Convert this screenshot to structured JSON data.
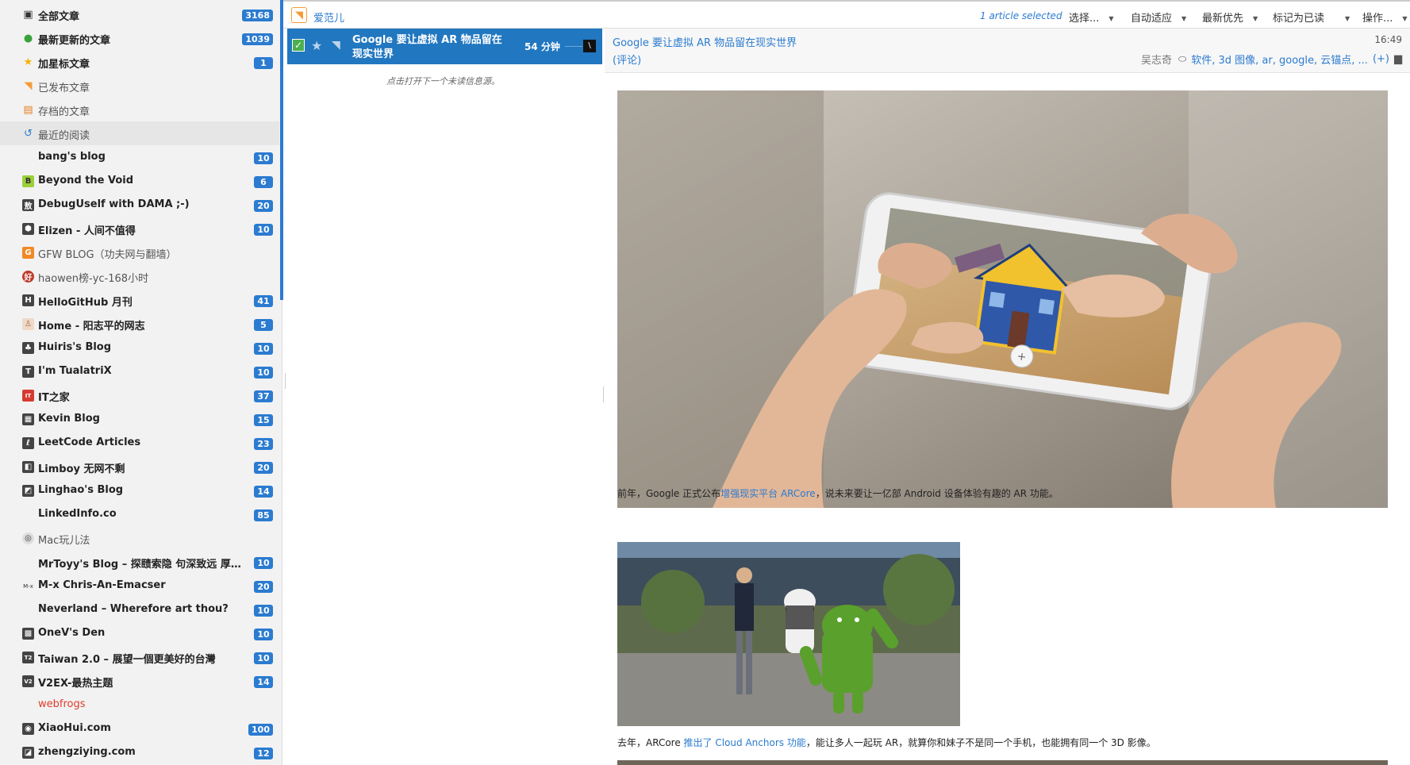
{
  "sidebar": {
    "items": [
      {
        "label": "全部文章",
        "count": "3168",
        "icon": "inbox-icon",
        "glyph": "▣",
        "style": "bold"
      },
      {
        "label": "最新更新的文章",
        "count": "1039",
        "icon": "fresh-icon",
        "glyph": "●",
        "style": "bold"
      },
      {
        "label": "加星标文章",
        "count": "1",
        "icon": "star-icon",
        "glyph": "★",
        "style": "bold"
      },
      {
        "label": "已发布文章",
        "count": "",
        "icon": "rss-icon",
        "glyph": "◥",
        "style": "gray"
      },
      {
        "label": "存档的文章",
        "count": "",
        "icon": "archive-icon",
        "glyph": "▤",
        "style": "gray"
      },
      {
        "label": "最近的阅读",
        "count": "",
        "icon": "history-icon",
        "glyph": "↺",
        "style": "gray"
      },
      {
        "label": "bang's blog",
        "count": "10",
        "icon": "",
        "glyph": "",
        "style": "bold"
      },
      {
        "label": "Beyond the Void",
        "count": "6",
        "icon": "btv-favicon-icon",
        "glyph": "B",
        "style": "bold"
      },
      {
        "label": "DebugUself with DAMA ;-)",
        "count": "20",
        "icon": "debug-favicon-icon",
        "glyph": "敖",
        "style": "bold"
      },
      {
        "label": "Elizen - 人间不值得",
        "count": "10",
        "icon": "elizen-favicon-icon",
        "glyph": "⬢",
        "style": "bold"
      },
      {
        "label": "GFW BLOG（功夫网与翻墙）",
        "count": "",
        "icon": "gfw-favicon-icon",
        "glyph": "G",
        "style": "gray"
      },
      {
        "label": "haowen榜-yc-168小时",
        "count": "",
        "icon": "haowen-favicon-icon",
        "glyph": "好",
        "style": "gray"
      },
      {
        "label": "HelloGitHub 月刊",
        "count": "41",
        "icon": "hellogithub-favicon-icon",
        "glyph": "H",
        "style": "bold"
      },
      {
        "label": "Home - 阳志平的网志",
        "count": "5",
        "icon": "home-favicon-icon",
        "glyph": "♙",
        "style": "bold"
      },
      {
        "label": "Huiris's Blog",
        "count": "10",
        "icon": "huiris-favicon-icon",
        "glyph": "♣",
        "style": "bold"
      },
      {
        "label": "I'm TualatriX",
        "count": "10",
        "icon": "tualatrix-favicon-icon",
        "glyph": "T",
        "style": "bold"
      },
      {
        "label": "IT之家",
        "count": "37",
        "icon": "ithome-favicon-icon",
        "glyph": "IT",
        "style": "bold"
      },
      {
        "label": "Kevin Blog",
        "count": "15",
        "icon": "kevin-favicon-icon",
        "glyph": "▦",
        "style": "bold"
      },
      {
        "label": "LeetCode Articles",
        "count": "23",
        "icon": "leetcode-favicon-icon",
        "glyph": "ℓ",
        "style": "bold"
      },
      {
        "label": "Limboy 无网不剩",
        "count": "20",
        "icon": "limboy-favicon-icon",
        "glyph": "◧",
        "style": "bold"
      },
      {
        "label": "Linghao's Blog",
        "count": "14",
        "icon": "linghao-favicon-icon",
        "glyph": "◩",
        "style": "bold"
      },
      {
        "label": "LinkedInfo.co",
        "count": "85",
        "icon": "",
        "glyph": "",
        "style": "bold"
      },
      {
        "label": "Mac玩儿法",
        "count": "",
        "icon": "mac-favicon-icon",
        "glyph": "◎",
        "style": "gray"
      },
      {
        "label": "MrToyy's Blog – 探赜索隐 句深致远 厚德博…",
        "count": "10",
        "icon": "",
        "glyph": "",
        "style": "bold"
      },
      {
        "label": "M-x Chris-An-Emacser",
        "count": "20",
        "icon": "mx-favicon-icon",
        "glyph": "M-x",
        "style": "bold"
      },
      {
        "label": "Neverland – Wherefore art thou?",
        "count": "10",
        "icon": "",
        "glyph": "",
        "style": "bold"
      },
      {
        "label": "OneV's Den",
        "count": "10",
        "icon": "onev-favicon-icon",
        "glyph": "▩",
        "style": "bold"
      },
      {
        "label": "Taiwan 2.0 – 展望一個更美好的台灣",
        "count": "10",
        "icon": "taiwan-favicon-icon",
        "glyph": "T2",
        "style": "bold"
      },
      {
        "label": "V2EX-最热主题",
        "count": "14",
        "icon": "v2ex-favicon-icon",
        "glyph": "V2",
        "style": "bold"
      },
      {
        "label": "webfrogs",
        "count": "",
        "icon": "",
        "glyph": "",
        "style": "red"
      },
      {
        "label": "XiaoHui.com",
        "count": "100",
        "icon": "xiaohui-favicon-icon",
        "glyph": "◉",
        "style": "bold"
      },
      {
        "label": "zhengziying.com",
        "count": "12",
        "icon": "zhengziying-favicon-icon",
        "glyph": "◪",
        "style": "bold"
      }
    ]
  },
  "toolbar": {
    "feed_name": "爱范儿",
    "selected_text": "1 article selected",
    "menus": [
      "选择...",
      "自动适应",
      "最新优先",
      "标记为已读",
      "操作..."
    ]
  },
  "headlines": {
    "row": {
      "title": "Google 要让虚拟 AR 物品留在现实世界",
      "time": "54 分钟"
    },
    "next_hint": "点击打开下一个未读信息源。"
  },
  "article": {
    "title": "Google 要让虚拟 AR 物品留在现实世界",
    "comments": "(评论)",
    "time": "16:49",
    "author": "吴志奇",
    "tags": "软件, 3d 图像, ar, google, 云锚点, ...",
    "tags_plus": "(+)",
    "para1_before": "前年，Google 正式公布",
    "para1_link": "增强现实平台 ARCore",
    "para1_after": "，说未来要让一亿部 Android 设备体验有趣的 AR 功能。",
    "para2_before": "去年，ARCore ",
    "para2_link": "推出了 Cloud Anchors 功能",
    "para2_after": "，能让多人一起玩 AR，就算你和妹子不是同一个手机，也能拥有同一个 3D 影像。"
  },
  "colors": {
    "accent": "#2b7bd0",
    "selected_row": "#2177c0",
    "badge": "#2b7bd0"
  }
}
